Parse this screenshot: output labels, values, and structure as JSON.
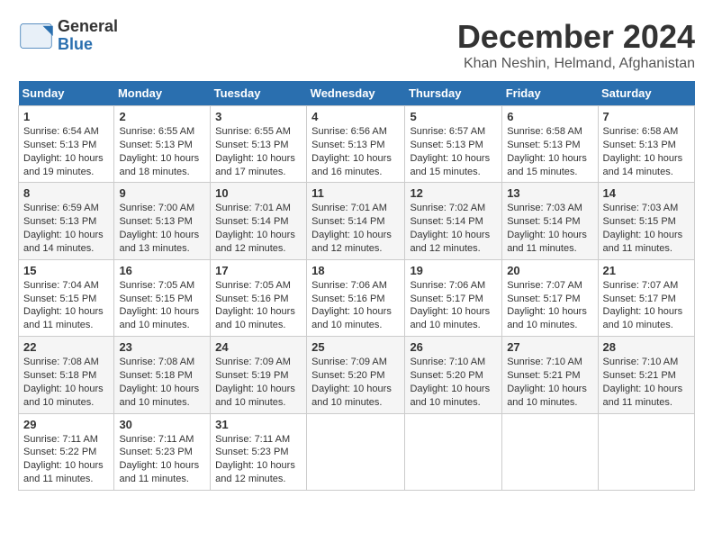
{
  "header": {
    "logo_line1": "General",
    "logo_line2": "Blue",
    "month_title": "December 2024",
    "location": "Khan Neshin, Helmand, Afghanistan"
  },
  "days_of_week": [
    "Sunday",
    "Monday",
    "Tuesday",
    "Wednesday",
    "Thursday",
    "Friday",
    "Saturday"
  ],
  "weeks": [
    [
      {
        "num": "1",
        "sunrise": "6:54 AM",
        "sunset": "5:13 PM",
        "daylight": "10 hours and 19 minutes."
      },
      {
        "num": "2",
        "sunrise": "6:55 AM",
        "sunset": "5:13 PM",
        "daylight": "10 hours and 18 minutes."
      },
      {
        "num": "3",
        "sunrise": "6:55 AM",
        "sunset": "5:13 PM",
        "daylight": "10 hours and 17 minutes."
      },
      {
        "num": "4",
        "sunrise": "6:56 AM",
        "sunset": "5:13 PM",
        "daylight": "10 hours and 16 minutes."
      },
      {
        "num": "5",
        "sunrise": "6:57 AM",
        "sunset": "5:13 PM",
        "daylight": "10 hours and 15 minutes."
      },
      {
        "num": "6",
        "sunrise": "6:58 AM",
        "sunset": "5:13 PM",
        "daylight": "10 hours and 15 minutes."
      },
      {
        "num": "7",
        "sunrise": "6:58 AM",
        "sunset": "5:13 PM",
        "daylight": "10 hours and 14 minutes."
      }
    ],
    [
      {
        "num": "8",
        "sunrise": "6:59 AM",
        "sunset": "5:13 PM",
        "daylight": "10 hours and 14 minutes."
      },
      {
        "num": "9",
        "sunrise": "7:00 AM",
        "sunset": "5:13 PM",
        "daylight": "10 hours and 13 minutes."
      },
      {
        "num": "10",
        "sunrise": "7:01 AM",
        "sunset": "5:14 PM",
        "daylight": "10 hours and 12 minutes."
      },
      {
        "num": "11",
        "sunrise": "7:01 AM",
        "sunset": "5:14 PM",
        "daylight": "10 hours and 12 minutes."
      },
      {
        "num": "12",
        "sunrise": "7:02 AM",
        "sunset": "5:14 PM",
        "daylight": "10 hours and 12 minutes."
      },
      {
        "num": "13",
        "sunrise": "7:03 AM",
        "sunset": "5:14 PM",
        "daylight": "10 hours and 11 minutes."
      },
      {
        "num": "14",
        "sunrise": "7:03 AM",
        "sunset": "5:15 PM",
        "daylight": "10 hours and 11 minutes."
      }
    ],
    [
      {
        "num": "15",
        "sunrise": "7:04 AM",
        "sunset": "5:15 PM",
        "daylight": "10 hours and 11 minutes."
      },
      {
        "num": "16",
        "sunrise": "7:05 AM",
        "sunset": "5:15 PM",
        "daylight": "10 hours and 10 minutes."
      },
      {
        "num": "17",
        "sunrise": "7:05 AM",
        "sunset": "5:16 PM",
        "daylight": "10 hours and 10 minutes."
      },
      {
        "num": "18",
        "sunrise": "7:06 AM",
        "sunset": "5:16 PM",
        "daylight": "10 hours and 10 minutes."
      },
      {
        "num": "19",
        "sunrise": "7:06 AM",
        "sunset": "5:17 PM",
        "daylight": "10 hours and 10 minutes."
      },
      {
        "num": "20",
        "sunrise": "7:07 AM",
        "sunset": "5:17 PM",
        "daylight": "10 hours and 10 minutes."
      },
      {
        "num": "21",
        "sunrise": "7:07 AM",
        "sunset": "5:17 PM",
        "daylight": "10 hours and 10 minutes."
      }
    ],
    [
      {
        "num": "22",
        "sunrise": "7:08 AM",
        "sunset": "5:18 PM",
        "daylight": "10 hours and 10 minutes."
      },
      {
        "num": "23",
        "sunrise": "7:08 AM",
        "sunset": "5:18 PM",
        "daylight": "10 hours and 10 minutes."
      },
      {
        "num": "24",
        "sunrise": "7:09 AM",
        "sunset": "5:19 PM",
        "daylight": "10 hours and 10 minutes."
      },
      {
        "num": "25",
        "sunrise": "7:09 AM",
        "sunset": "5:20 PM",
        "daylight": "10 hours and 10 minutes."
      },
      {
        "num": "26",
        "sunrise": "7:10 AM",
        "sunset": "5:20 PM",
        "daylight": "10 hours and 10 minutes."
      },
      {
        "num": "27",
        "sunrise": "7:10 AM",
        "sunset": "5:21 PM",
        "daylight": "10 hours and 10 minutes."
      },
      {
        "num": "28",
        "sunrise": "7:10 AM",
        "sunset": "5:21 PM",
        "daylight": "10 hours and 11 minutes."
      }
    ],
    [
      {
        "num": "29",
        "sunrise": "7:11 AM",
        "sunset": "5:22 PM",
        "daylight": "10 hours and 11 minutes."
      },
      {
        "num": "30",
        "sunrise": "7:11 AM",
        "sunset": "5:23 PM",
        "daylight": "10 hours and 11 minutes."
      },
      {
        "num": "31",
        "sunrise": "7:11 AM",
        "sunset": "5:23 PM",
        "daylight": "10 hours and 12 minutes."
      },
      null,
      null,
      null,
      null
    ]
  ]
}
